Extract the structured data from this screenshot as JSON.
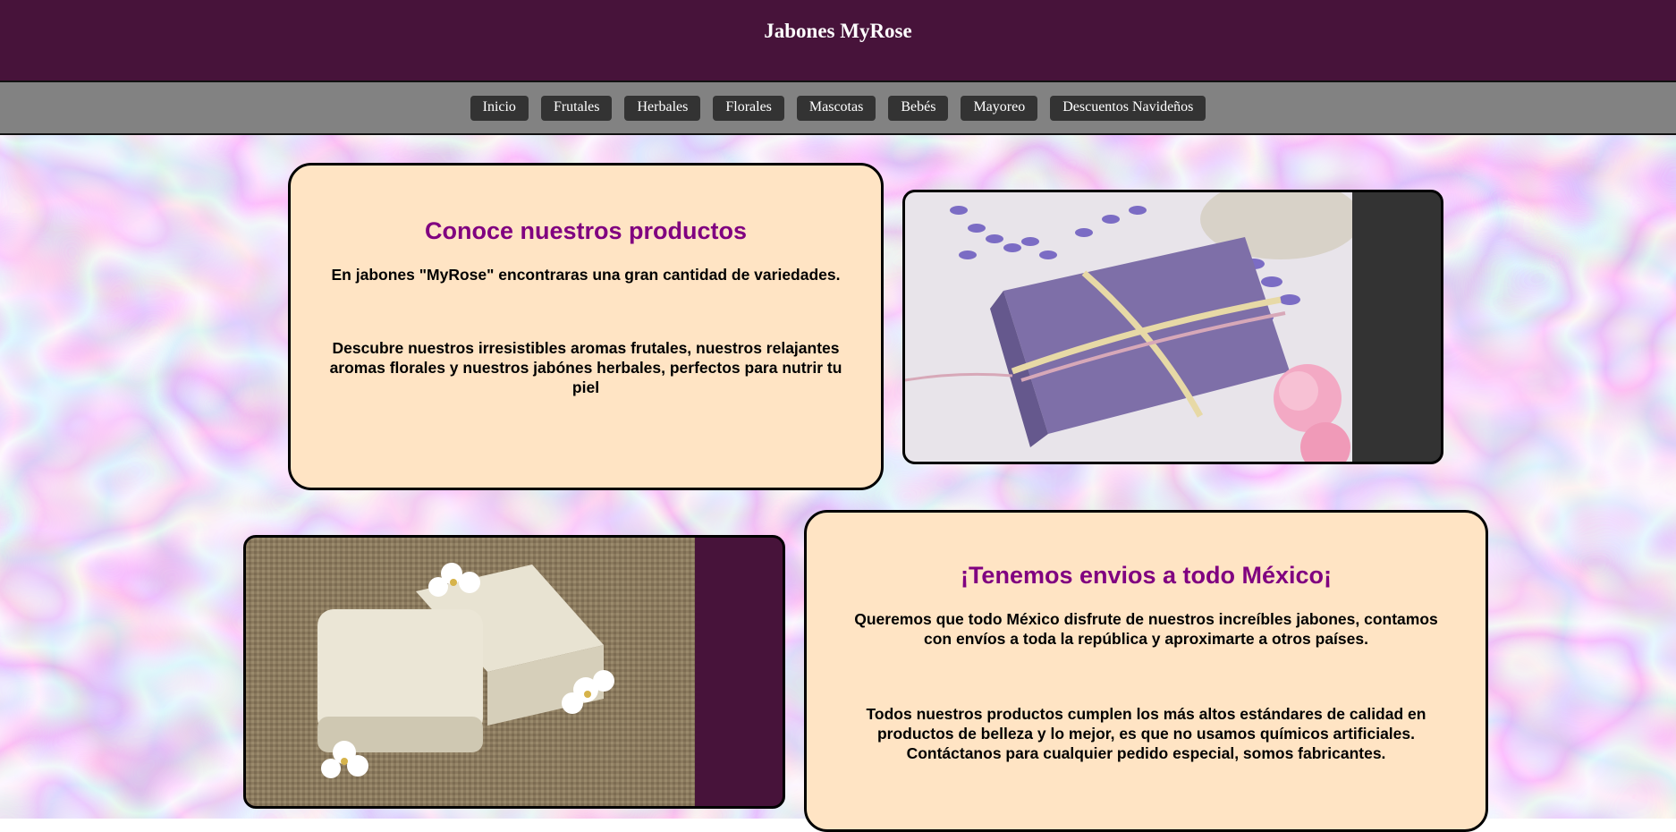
{
  "header": {
    "title": "Jabones MyRose"
  },
  "nav": {
    "items": [
      {
        "label": "Inicio"
      },
      {
        "label": "Frutales"
      },
      {
        "label": "Herbales"
      },
      {
        "label": "Florales"
      },
      {
        "label": "Mascotas"
      },
      {
        "label": "Bebés"
      },
      {
        "label": "Mayoreo"
      },
      {
        "label": "Descuentos Navideños"
      }
    ]
  },
  "section1": {
    "title": "Conoce nuestros productos",
    "p1": "En jabones \"MyRose\" encontraras una gran cantidad de variedades.",
    "p2": "Descubre nuestros irresistibles aromas frutales, nuestros relajantes aromas florales y nuestros jabónes herbales, perfectos para nutrir tu piel"
  },
  "section2": {
    "title": "¡Tenemos envios a todo México¡",
    "p1": "Queremos que todo México disfrute de nuestros increíbles jabones, contamos con envíos a toda la república y aproximarte a otros países.",
    "p2": "Todos nuestros productos cumplen los más altos estándares de calidad en productos de belleza y lo mejor, es que no usamos químicos artificiales. Contáctanos para cualquier pedido especial, somos fabricantes."
  },
  "colors": {
    "header_bg": "#47133a",
    "nav_bg": "#828282",
    "nav_button": "#333333",
    "card_bg": "#ffe4c4",
    "heading": "#800080"
  }
}
